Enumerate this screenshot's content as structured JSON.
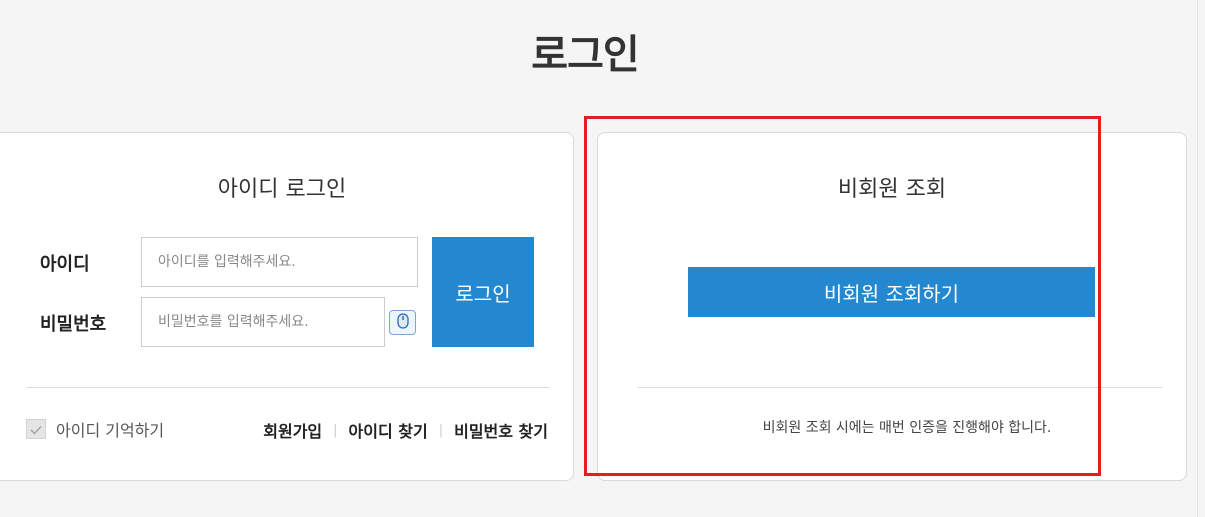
{
  "page": {
    "title": "로그인"
  },
  "member_login": {
    "heading": "아이디 로그인",
    "id_label": "아이디",
    "id_placeholder": "아이디를 입력해주세요.",
    "pw_label": "비밀번호",
    "pw_placeholder": "비밀번호를 입력해주세요.",
    "keyboard_icon": "mouse-icon",
    "login_button": "로그인",
    "remember_label": "아이디 기억하기",
    "remember_checked": true,
    "links": [
      "회원가입",
      "아이디 찾기",
      "비밀번호 찾기"
    ]
  },
  "guest_lookup": {
    "heading": "비회원 조회",
    "button": "비회원 조회하기",
    "note": "비회원 조회 시에는 매번 인증을 진행해야 합니다."
  },
  "colors": {
    "primary": "#2388cf",
    "highlight": "#e02020",
    "background": "#f5f5f5"
  }
}
